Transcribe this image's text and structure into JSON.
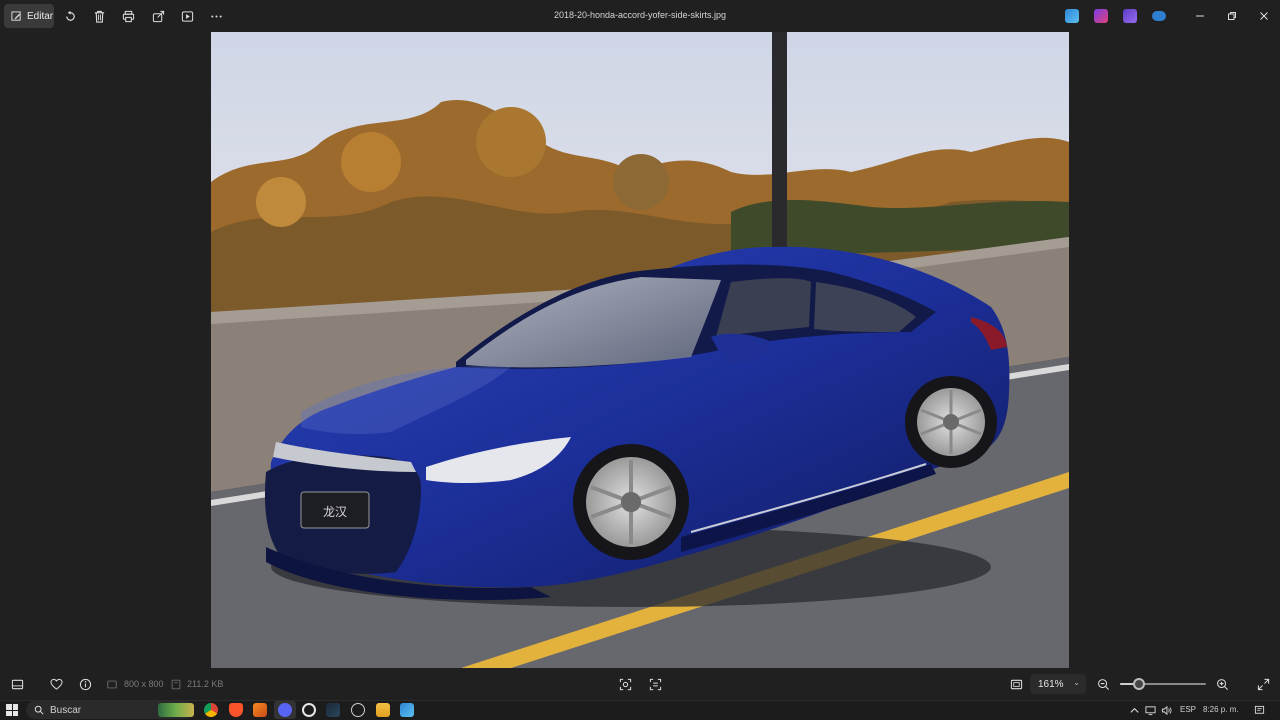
{
  "toolbar": {
    "edit_label": "Editar",
    "file_name": "2018-20-honda-accord-yofer-side-skirts.jpg"
  },
  "toolbar_icons": [
    "edit-icon",
    "rotate-icon",
    "delete-icon",
    "print-icon",
    "share-icon",
    "slideshow-icon",
    "more-icon"
  ],
  "cloud_apps": [
    "photos-app-icon",
    "clipchamp-icon",
    "designer-icon",
    "onedrive-icon"
  ],
  "photo": {
    "subject": "blue lowered sedan",
    "plate_text": "龙汉"
  },
  "status": {
    "dimensions": "800 x 800",
    "file_size": "211.2 KB",
    "zoom_level": "161%",
    "zoom_fraction": 0.22
  },
  "taskbar": {
    "search_placeholder": "Buscar",
    "language": "ESP",
    "time": "8:26 p. m."
  },
  "colors": {
    "background": "#202020",
    "car_blue": "#1c2f9a",
    "road_line": "#e3b23c"
  }
}
